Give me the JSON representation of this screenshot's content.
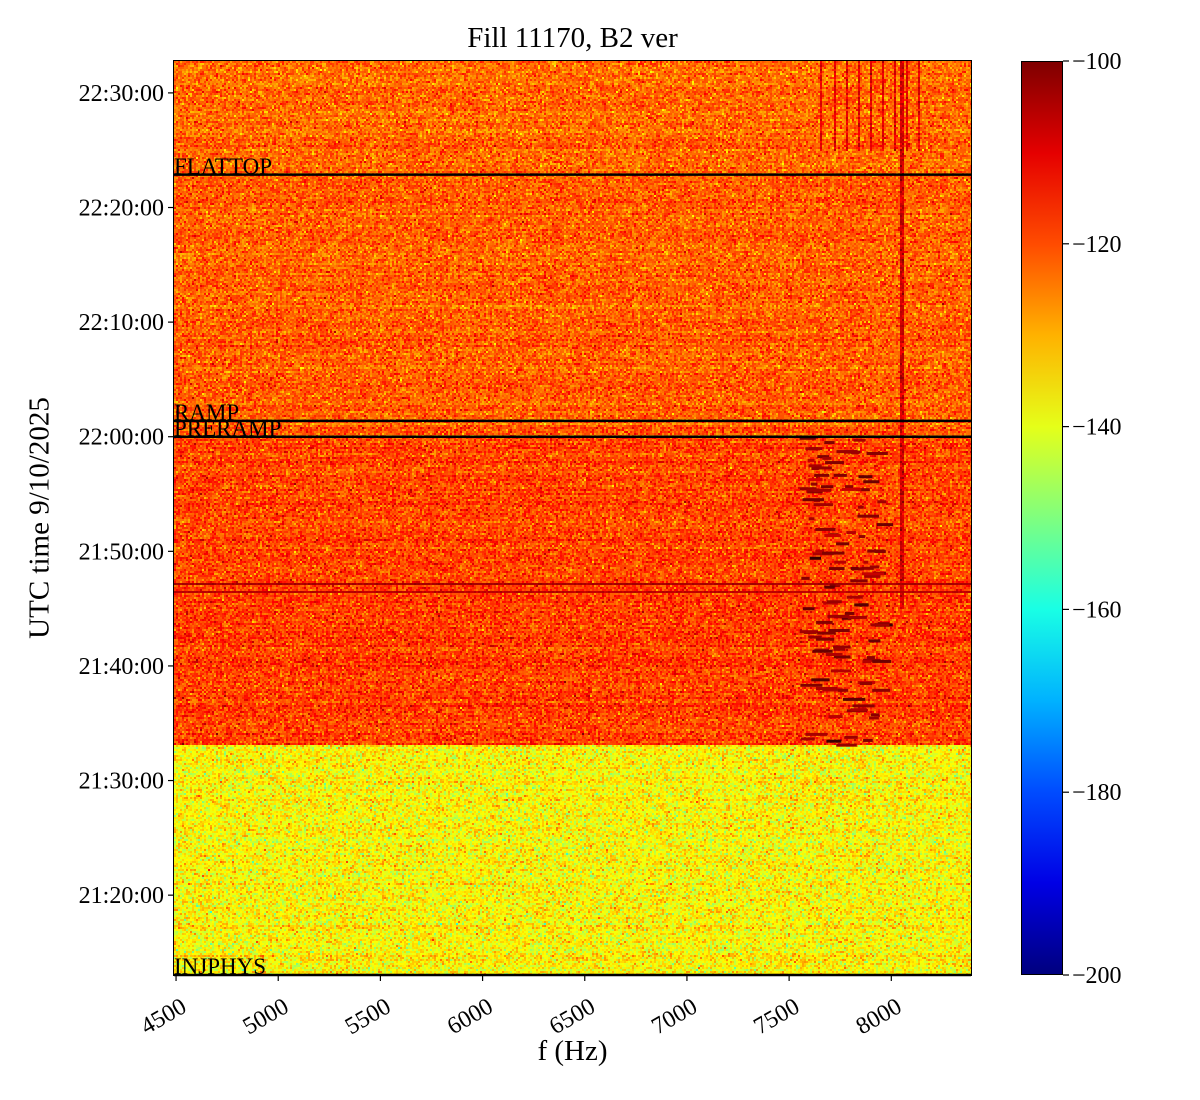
{
  "chart_data": {
    "type": "heatmap",
    "title": "Fill 11170, B2 ver",
    "xlabel": "f (Hz)",
    "ylabel": "UTC time 9/10/2025",
    "xlim": [
      4490,
      8390
    ],
    "ylim": [
      "21:13:02",
      "22:32:47"
    ],
    "x_ticks": [
      4500,
      5000,
      5500,
      6000,
      6500,
      7000,
      7500,
      8000
    ],
    "x_tick_labels": [
      "4500",
      "5000",
      "5500",
      "6000",
      "6500",
      "7000",
      "7500",
      "8000"
    ],
    "y_ticks": [
      "21:20:00",
      "21:30:00",
      "21:40:00",
      "21:50:00",
      "22:00:00",
      "22:10:00",
      "22:20:00",
      "22:30:00"
    ],
    "colorbar": {
      "colormap": "jet",
      "range": [
        -200,
        -100
      ],
      "ticks": [
        -100,
        -120,
        -140,
        -160,
        -180,
        -200
      ],
      "tick_labels": [
        "−100",
        "−120",
        "−140",
        "−160",
        "−180",
        "−200"
      ]
    },
    "events": [
      {
        "label": "FLATTOP",
        "time": "22:22:52"
      },
      {
        "label": "RAMP",
        "time": "22:01:23"
      },
      {
        "label": "PRERAMP",
        "time": "22:00:00"
      },
      {
        "label": "INJPHYS",
        "time": "21:13:02"
      }
    ],
    "regions": [
      {
        "name": "before injection",
        "t_start": "21:13:02",
        "t_end": "21:33:13",
        "mean_db": -137
      },
      {
        "name": "injection",
        "t_start": "21:33:13",
        "t_end": "22:00:00",
        "mean_db": -119
      },
      {
        "name": "ramp",
        "t_start": "22:00:00",
        "t_end": "22:22:52",
        "mean_db": -122
      },
      {
        "name": "flattop",
        "t_start": "22:22:52",
        "t_end": "22:32:47",
        "mean_db": -123
      }
    ],
    "features": [
      {
        "name": "oscillation bursts",
        "f_range": [
          7550,
          7950
        ],
        "t_range": [
          "21:33:13",
          "22:00:00"
        ],
        "level_db": -102
      },
      {
        "name": "vertical line",
        "f": 8050,
        "t_range": [
          "21:45:00",
          "22:32:47"
        ],
        "level_db": -108
      },
      {
        "name": "horizontal line",
        "t": "21:47:13",
        "level_db": -104
      },
      {
        "name": "horizontal line",
        "t": "21:46:31",
        "level_db": -106
      },
      {
        "name": "vertical lines",
        "f_range": [
          7650,
          8150
        ],
        "t_range": [
          "22:25:00",
          "22:32:47"
        ],
        "level_db": -110
      }
    ]
  }
}
